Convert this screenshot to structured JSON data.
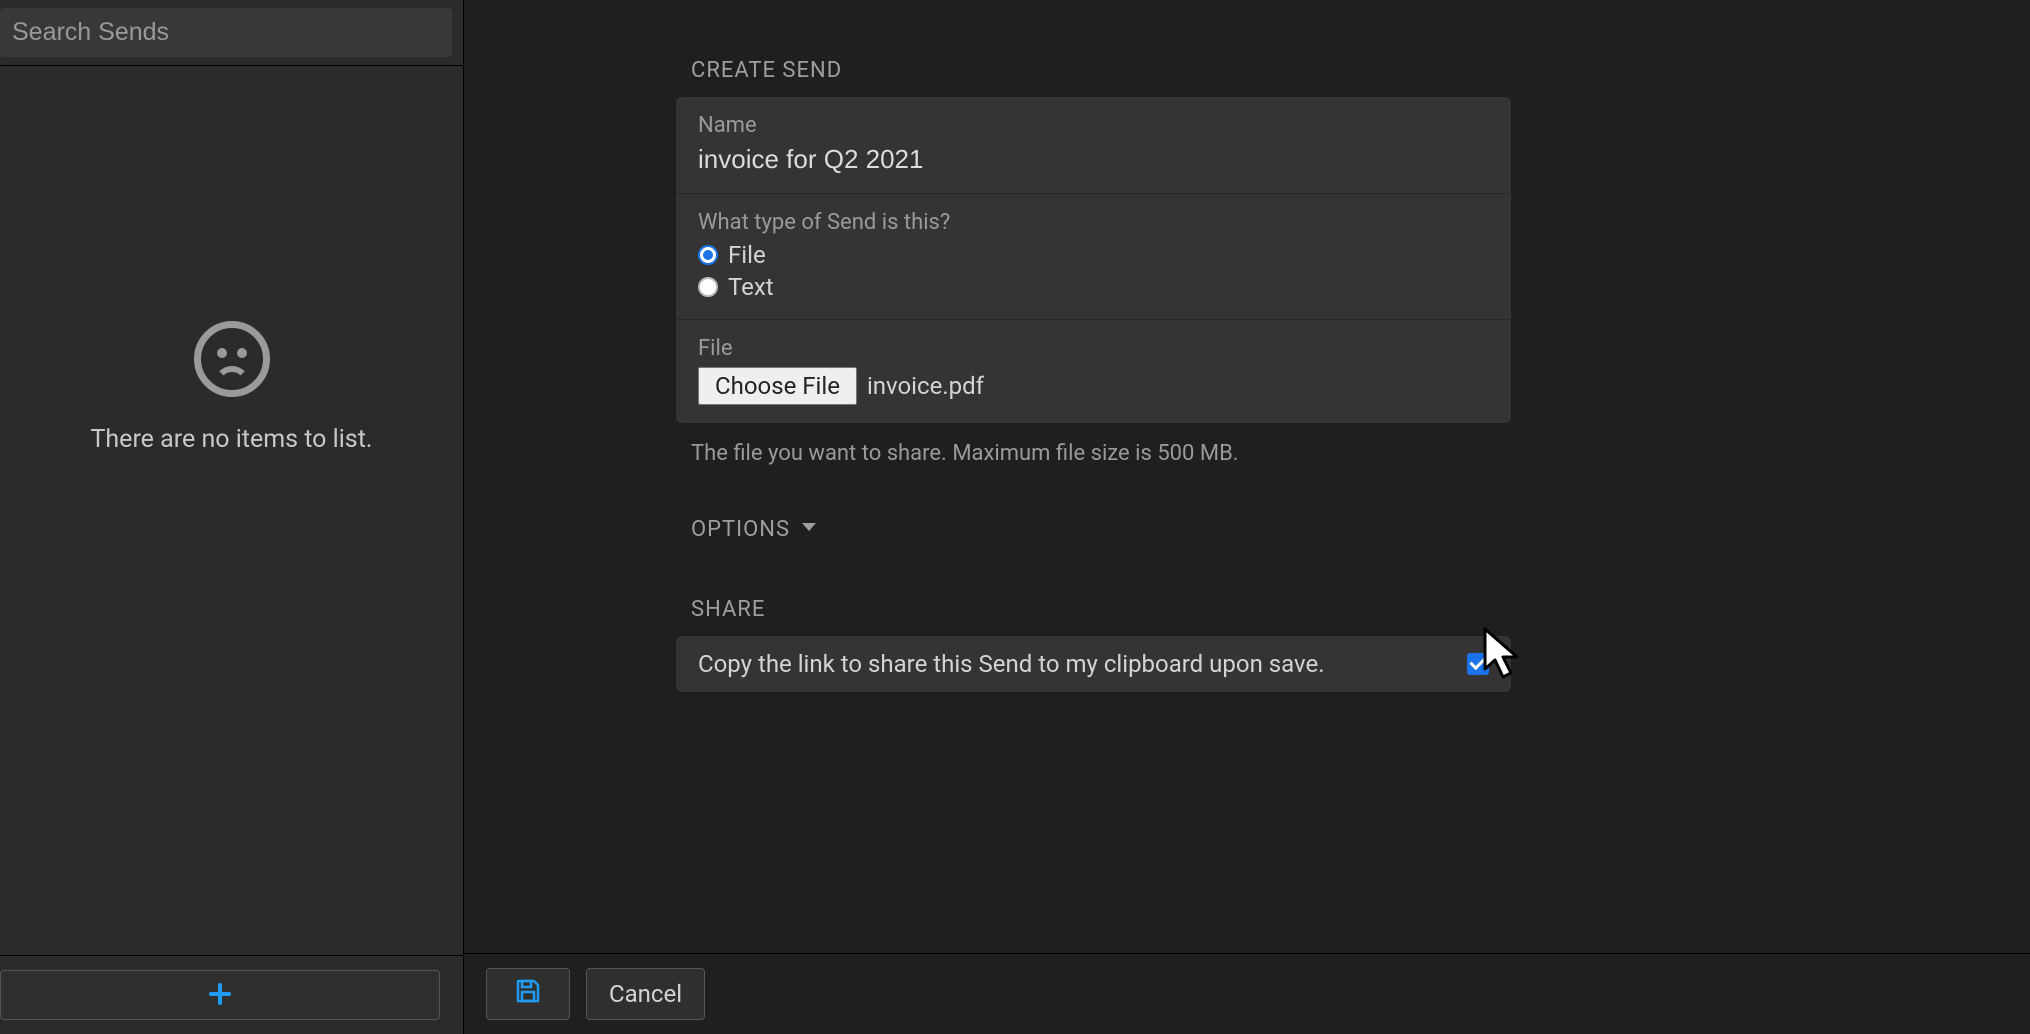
{
  "sidebar": {
    "search_placeholder": "Search Sends",
    "empty_text": "There are no items to list."
  },
  "create_send": {
    "header": "CREATE SEND",
    "name_label": "Name",
    "name_value": "invoice for Q2 2021",
    "type_label": "What type of Send is this?",
    "type_options": {
      "file": "File",
      "text": "Text"
    },
    "type_selected": "file",
    "file_label": "File",
    "choose_file_button": "Choose File",
    "file_name": "invoice.pdf",
    "file_helper": "The file you want to share. Maximum file size is 500 MB."
  },
  "options": {
    "header": "OPTIONS"
  },
  "share": {
    "header": "SHARE",
    "copy_link_label": "Copy the link to share this Send to my clipboard upon save.",
    "copy_link_checked": true
  },
  "footer": {
    "cancel_label": "Cancel"
  }
}
